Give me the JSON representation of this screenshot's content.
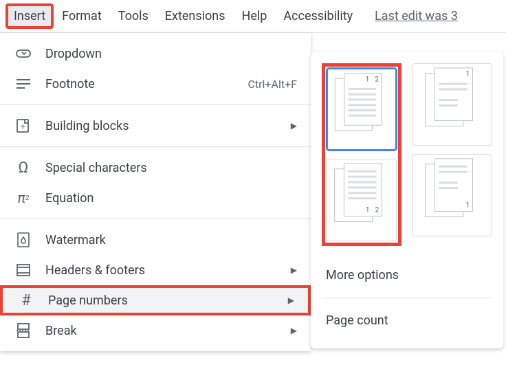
{
  "menubar": {
    "items": [
      {
        "label": "Insert",
        "selected": true,
        "highlighted": true
      },
      {
        "label": "Format"
      },
      {
        "label": "Tools"
      },
      {
        "label": "Extensions"
      },
      {
        "label": "Help"
      },
      {
        "label": "Accessibility"
      }
    ],
    "last_edit": "Last edit was 3"
  },
  "dropdown": {
    "items": [
      {
        "icon": "dropdown-icon",
        "label": "Dropdown"
      },
      {
        "icon": "footnote-icon",
        "label": "Footnote",
        "shortcut": "Ctrl+Alt+F"
      },
      {
        "separator": true
      },
      {
        "icon": "building-blocks-icon",
        "label": "Building blocks",
        "submenu": true
      },
      {
        "separator": true
      },
      {
        "icon": "omega-icon",
        "label": "Special characters"
      },
      {
        "icon": "pi-icon",
        "label": "Equation"
      },
      {
        "separator": true
      },
      {
        "icon": "watermark-icon",
        "label": "Watermark"
      },
      {
        "icon": "headers-footers-icon",
        "label": "Headers & footers",
        "submenu": true
      },
      {
        "icon": "hash-icon",
        "label": "Page numbers",
        "submenu": true,
        "active": true,
        "highlighted": true
      },
      {
        "icon": "break-icon",
        "label": "Break",
        "submenu": true
      }
    ]
  },
  "submenu": {
    "more_options": "More options",
    "page_count": "Page count",
    "thumbs": [
      {
        "name": "header-right-12",
        "selected": true
      },
      {
        "name": "header-right-1"
      },
      {
        "name": "footer-right-12"
      },
      {
        "name": "footer-right-1"
      }
    ]
  }
}
